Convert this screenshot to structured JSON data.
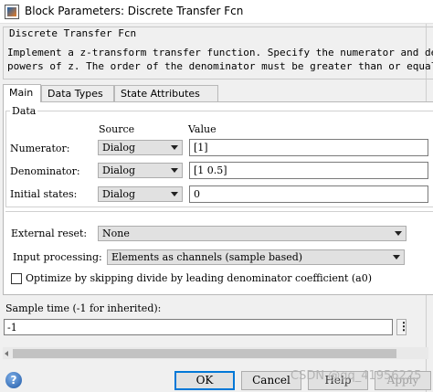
{
  "window": {
    "title": "Block Parameters: Discrete Transfer Fcn",
    "icon": "simulink-block-icon"
  },
  "block": {
    "group_label": "Discrete Transfer Fcn",
    "description_line1": "Implement a z-transform transfer function. Specify the numerator and denominat",
    "description_line2": "powers of z. The order of the denominator must be greater than or equal to the"
  },
  "tabs": [
    {
      "label": "Main",
      "active": true
    },
    {
      "label": "Data Types",
      "active": false
    },
    {
      "label": "State Attributes",
      "active": false
    }
  ],
  "data_group": {
    "label": "Data",
    "source_header": "Source",
    "value_header": "Value",
    "rows": [
      {
        "label": "Numerator:",
        "source": "Dialog",
        "value": "[1]"
      },
      {
        "label": "Denominator:",
        "source": "Dialog",
        "value": "[1 0.5]"
      },
      {
        "label": "Initial states:",
        "source": "Dialog",
        "value": "0"
      }
    ]
  },
  "external_reset": {
    "label": "External reset:",
    "value": "None"
  },
  "input_processing": {
    "label": "Input processing:",
    "value": "Elements as channels (sample based)"
  },
  "optimize": {
    "label": "Optimize by skipping divide by leading denominator coefficient (a0)",
    "checked": false
  },
  "sample_time": {
    "label": "Sample time (-1 for inherited):",
    "value": "-1"
  },
  "buttons": {
    "ok": "OK",
    "cancel": "Cancel",
    "help": "Help",
    "apply": "Apply"
  },
  "watermark": "CSDN @qq_41956225",
  "colors": {
    "accent": "#0078d7",
    "background": "#f0f0f0"
  }
}
